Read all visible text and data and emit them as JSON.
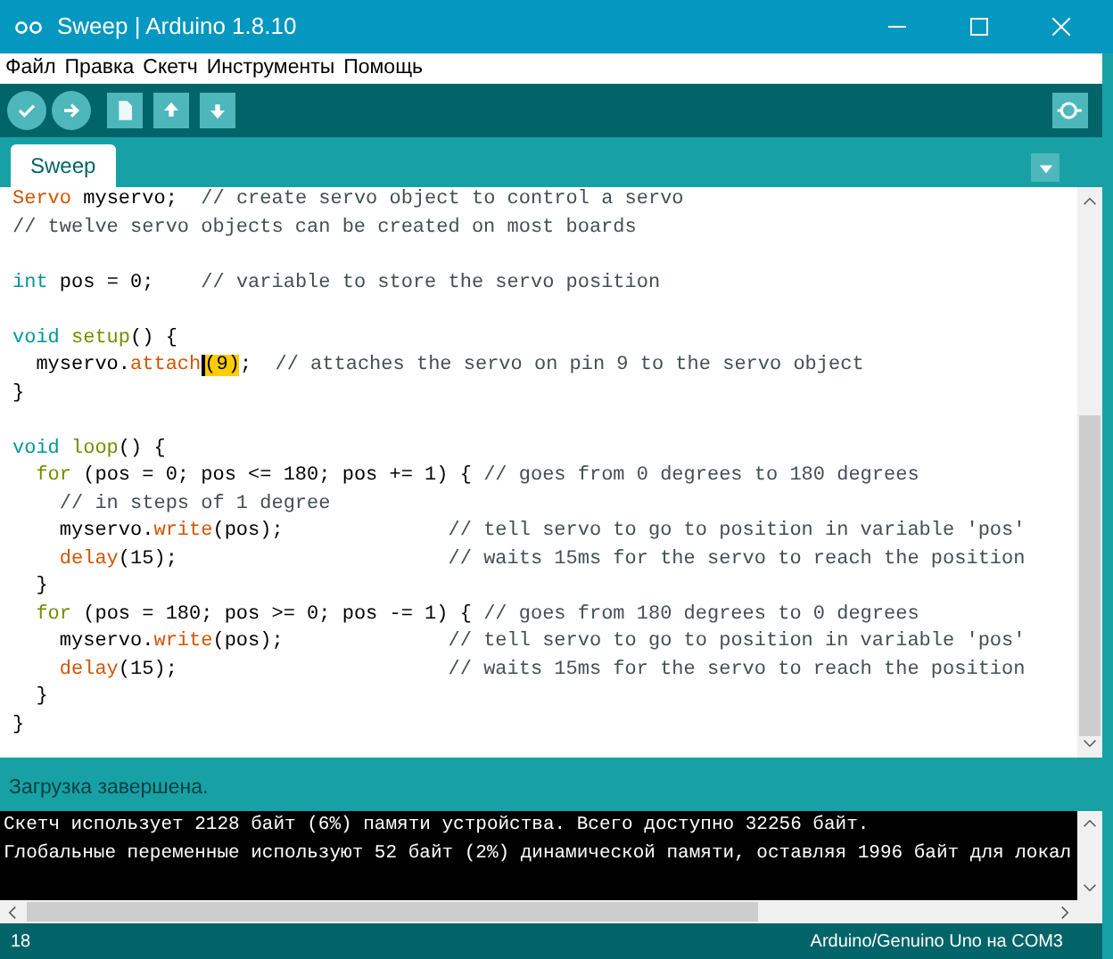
{
  "window": {
    "title": "Sweep | Arduino 1.8.10"
  },
  "menu": [
    "Файл",
    "Правка",
    "Скетч",
    "Инструменты",
    "Помощь"
  ],
  "toolbar": [
    {
      "kind": "verify"
    },
    {
      "kind": "upload"
    },
    {
      "kind": "new"
    },
    {
      "kind": "open"
    },
    {
      "kind": "save"
    }
  ],
  "tabs": [
    {
      "label": "Sweep",
      "selected": true
    }
  ],
  "editor": {
    "lines": [
      {
        "kind": "code",
        "segments": [
          {
            "kind": "func",
            "text": "Servo"
          },
          {
            "kind": "plain",
            "text": " myservo;  "
          },
          {
            "kind": "comment",
            "text": "// create servo object to control a servo"
          }
        ]
      },
      {
        "kind": "code",
        "segments": [
          {
            "kind": "comment",
            "text": "// twelve servo objects can be created on most boards"
          }
        ]
      },
      {
        "kind": "blank"
      },
      {
        "kind": "code",
        "segments": [
          {
            "kind": "type",
            "text": "int"
          },
          {
            "kind": "plain",
            "text": " pos = 0;    "
          },
          {
            "kind": "comment",
            "text": "// variable to store the servo position"
          }
        ]
      },
      {
        "kind": "blank"
      },
      {
        "kind": "code",
        "segments": [
          {
            "kind": "type",
            "text": "void"
          },
          {
            "kind": "control",
            "text": " setup"
          },
          {
            "kind": "plain",
            "text": "() {"
          }
        ]
      },
      {
        "kind": "code",
        "segments": [
          {
            "kind": "plain",
            "text": "  myservo."
          },
          {
            "kind": "func",
            "text": "attach"
          },
          {
            "kind": "highlight",
            "text": "(9)"
          },
          {
            "kind": "plain",
            "text": ";  "
          },
          {
            "kind": "comment",
            "text": "// attaches the servo on pin 9 to the servo object"
          }
        ]
      },
      {
        "kind": "code",
        "segments": [
          {
            "kind": "plain",
            "text": "}"
          }
        ]
      },
      {
        "kind": "blank"
      },
      {
        "kind": "code",
        "segments": [
          {
            "kind": "type",
            "text": "void"
          },
          {
            "kind": "control",
            "text": " loop"
          },
          {
            "kind": "plain",
            "text": "() {"
          }
        ]
      },
      {
        "kind": "code",
        "segments": [
          {
            "kind": "control",
            "text": "  for"
          },
          {
            "kind": "plain",
            "text": " (pos = 0; pos <= 180; pos += 1) { "
          },
          {
            "kind": "comment",
            "text": "// goes from 0 degrees to 180 degrees"
          }
        ]
      },
      {
        "kind": "code",
        "segments": [
          {
            "kind": "comment",
            "text": "    // in steps of 1 degree"
          }
        ]
      },
      {
        "kind": "code",
        "segments": [
          {
            "kind": "plain",
            "text": "    myservo."
          },
          {
            "kind": "func",
            "text": "write"
          },
          {
            "kind": "plain",
            "text": "(pos);              "
          },
          {
            "kind": "comment",
            "text": "// tell servo to go to position in variable 'pos'"
          }
        ]
      },
      {
        "kind": "code",
        "segments": [
          {
            "kind": "func",
            "text": "    delay"
          },
          {
            "kind": "plain",
            "text": "(15);                       "
          },
          {
            "kind": "comment",
            "text": "// waits 15ms for the servo to reach the position"
          }
        ]
      },
      {
        "kind": "code",
        "segments": [
          {
            "kind": "plain",
            "text": "  }"
          }
        ]
      },
      {
        "kind": "code",
        "segments": [
          {
            "kind": "control",
            "text": "  for"
          },
          {
            "kind": "plain",
            "text": " (pos = 180; pos >= 0; pos -= 1) { "
          },
          {
            "kind": "comment",
            "text": "// goes from 180 degrees to 0 degrees"
          }
        ]
      },
      {
        "kind": "code",
        "segments": [
          {
            "kind": "plain",
            "text": "    myservo."
          },
          {
            "kind": "func",
            "text": "write"
          },
          {
            "kind": "plain",
            "text": "(pos);              "
          },
          {
            "kind": "comment",
            "text": "// tell servo to go to position in variable 'pos'"
          }
        ]
      },
      {
        "kind": "code",
        "segments": [
          {
            "kind": "func",
            "text": "    delay"
          },
          {
            "kind": "plain",
            "text": "(15);                       "
          },
          {
            "kind": "comment",
            "text": "// waits 15ms for the servo to reach the position"
          }
        ]
      },
      {
        "kind": "code",
        "segments": [
          {
            "kind": "plain",
            "text": "  }"
          }
        ]
      },
      {
        "kind": "code",
        "segments": [
          {
            "kind": "plain",
            "text": "}"
          }
        ]
      }
    ]
  },
  "status": "Загрузка завершена.",
  "console": [
    "Скетч использует 2128 байт (6%) памяти устройства. Всего доступно 32256 байт.",
    "Глобальные переменные используют 52 байт (2%) динамической памяти, оставляя 1996 байт для локал"
  ],
  "footer": {
    "line": "18",
    "board": "Arduino/Genuino Uno на COM3"
  }
}
